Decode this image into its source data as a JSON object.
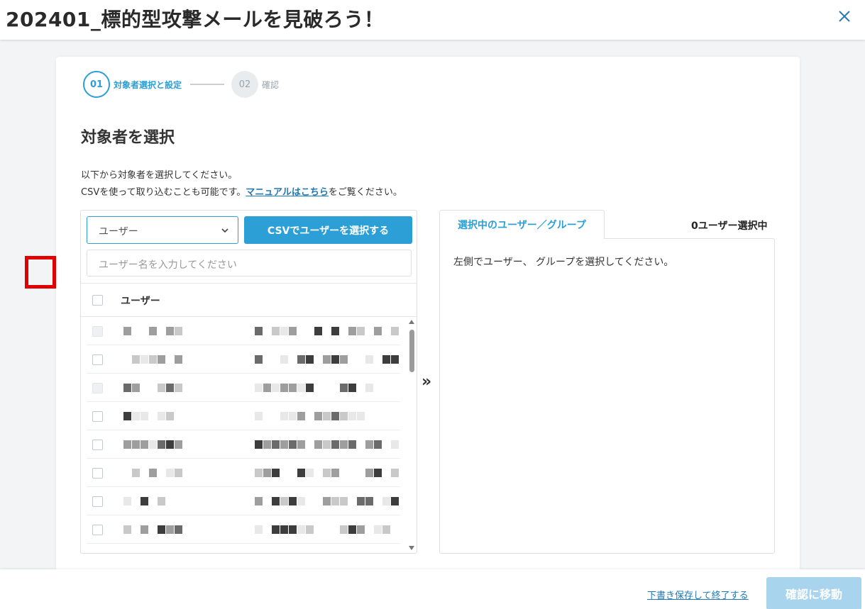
{
  "header": {
    "title": "202401_標的型攻撃メールを見破ろう！",
    "close_icon": "close-icon"
  },
  "stepper": {
    "steps": [
      {
        "number": "01",
        "label": "対象者選択と設定",
        "state": "active"
      },
      {
        "number": "02",
        "label": "確認",
        "state": "inactive"
      }
    ]
  },
  "main": {
    "section_title": "対象者を選択",
    "desc_line1": "以下から対象者を選択してください。",
    "desc_line2_prefix": "CSVを使って取り込むことも可能です。",
    "manual_link": "マニュアルはこちら",
    "desc_line2_suffix": "をご覧ください。"
  },
  "left_panel": {
    "type_select": {
      "value": "ユーザー"
    },
    "csv_button": "CSVでユーザーを選択する",
    "search": {
      "placeholder": "ユーザー名を入力してください"
    },
    "column_header": "ユーザー",
    "row_count": 9
  },
  "right_panel": {
    "tab_label": "選択中のユーザー／グループ",
    "selection_count": "0ユーザー選択中",
    "empty_message": "左側でユーザー、 グループを選択してください。"
  },
  "footer": {
    "save_exit": "下書き保存して終了する",
    "next_button": "確認に移動"
  },
  "colors": {
    "accent": "#2b9fd6",
    "link": "#1f78b4",
    "disabled_button": "#a8d4ee",
    "highlight": "#e00000"
  }
}
